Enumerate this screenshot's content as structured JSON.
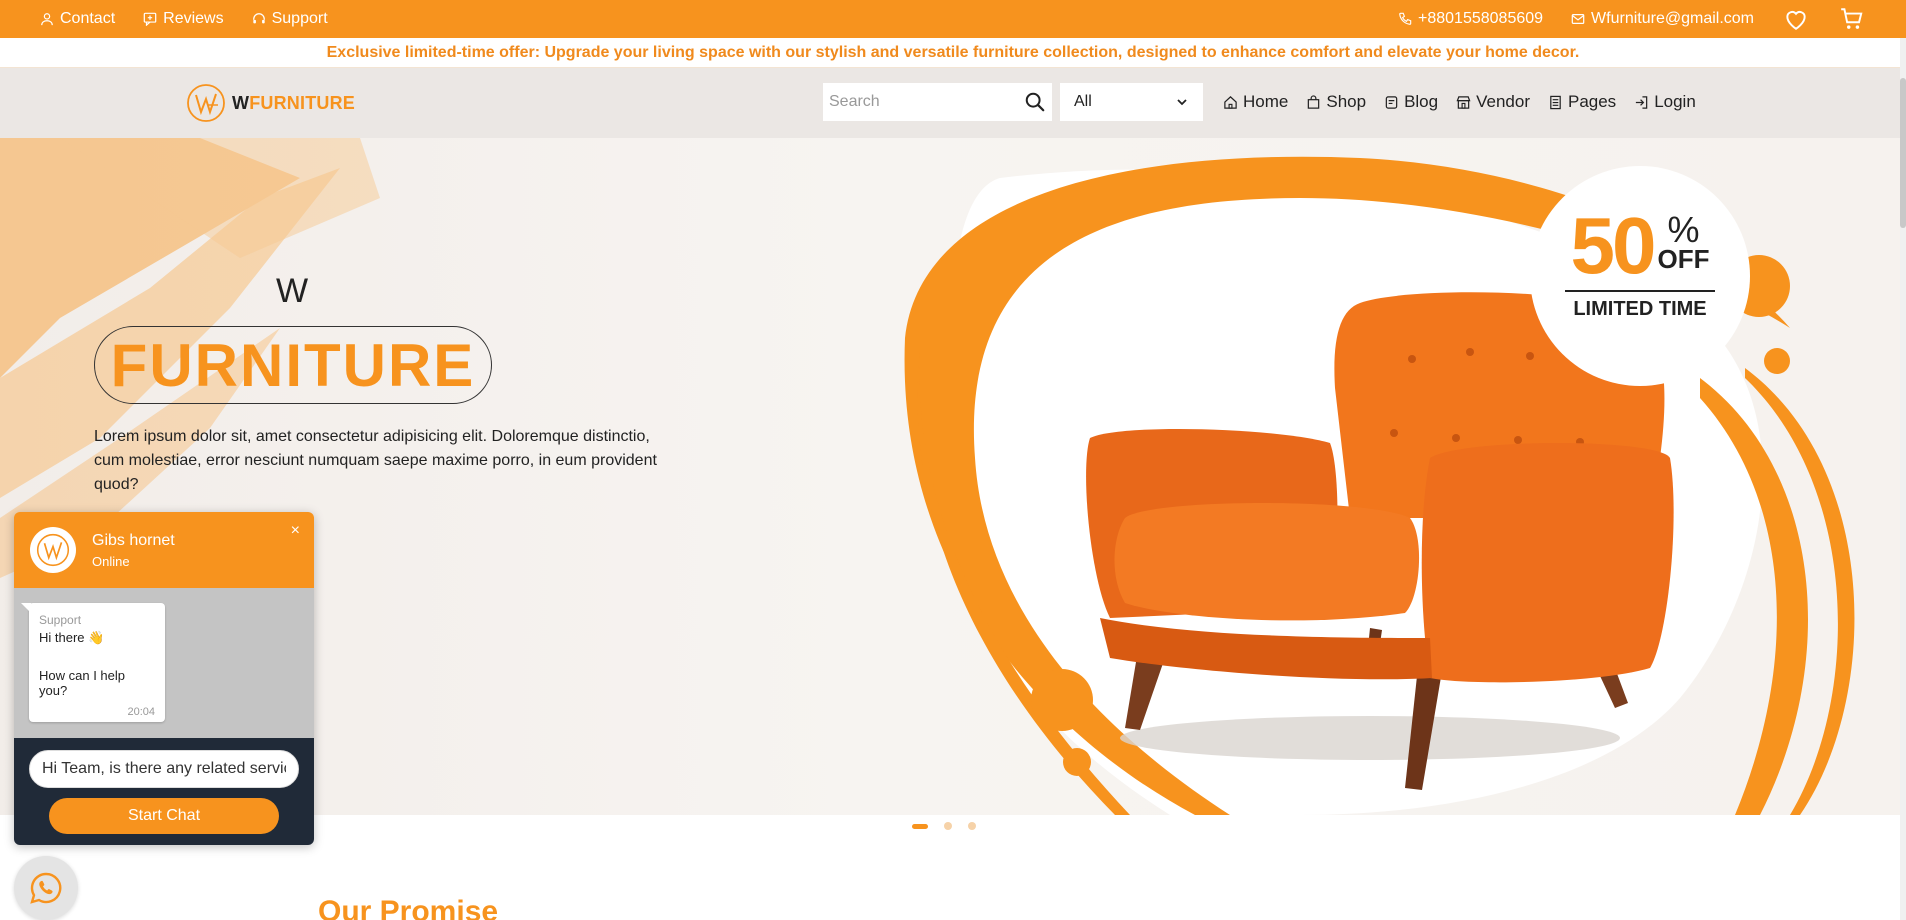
{
  "colors": {
    "accent": "#f7931e",
    "chat_footer": "#202a38"
  },
  "topbar": {
    "contact": "Contact",
    "reviews": "Reviews",
    "support": "Support",
    "phone": "+8801558085609",
    "email": "Wfurniture@gmail.com",
    "icons": [
      "phone-icon",
      "mail-icon",
      "heart-icon",
      "cart-icon"
    ]
  },
  "offer": "Exclusive limited-time offer: Upgrade your living space with our stylish and versatile furniture collection, designed to enhance comfort and elevate your home decor.",
  "nav": {
    "logo_w": "W",
    "logo_rest": "FURNITURE",
    "search_placeholder": "Search",
    "category": "All",
    "menu": [
      {
        "label": "Home",
        "icon": "home-icon"
      },
      {
        "label": "Shop",
        "icon": "bag-icon"
      },
      {
        "label": "Blog",
        "icon": "blog-icon"
      },
      {
        "label": "Vendor",
        "icon": "store-icon"
      },
      {
        "label": "Pages",
        "icon": "pages-icon"
      },
      {
        "label": "Login",
        "icon": "login-icon"
      }
    ]
  },
  "hero": {
    "pre": "W",
    "title": "FURNITURE",
    "description": "Lorem ipsum dolor sit, amet consectetur adipisicing elit. Doloremque distinctio, cum molestiae, error nesciunt numquam saepe maxime porro, in eum provident quod?",
    "badge_number": "50",
    "badge_percent": "%",
    "badge_off": "OFF",
    "badge_limited": "LIMITED TIME",
    "slides": 3,
    "active_slide": 1
  },
  "section_title": "Our Promise",
  "chat": {
    "name": "Gibs hornet",
    "status": "Online",
    "close": "×",
    "sender": "Support",
    "greeting": "Hi there 👋",
    "question": "How can I help you?",
    "time": "20:04",
    "input_value": "Hi Team, is there any related service available ?",
    "button": "Start Chat"
  }
}
